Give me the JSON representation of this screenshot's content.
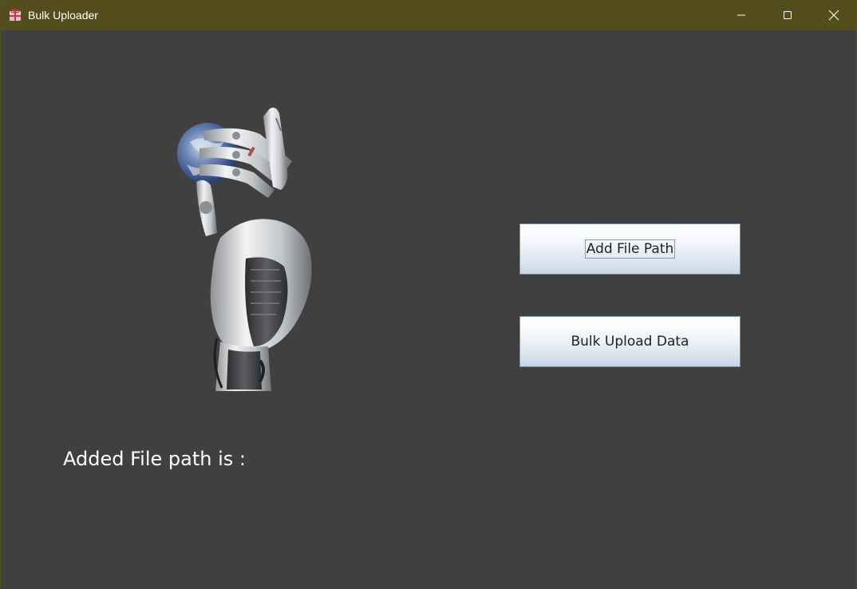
{
  "window": {
    "title": "Bulk Uploader",
    "app_icon": "package-icon",
    "controls": {
      "minimize_icon": "minimize-icon",
      "maximize_icon": "maximize-icon",
      "close_icon": "close-icon"
    }
  },
  "main": {
    "image": "robot-hand-holding-globe",
    "add_file_path_label": "Add File Path",
    "bulk_upload_label": "Bulk Upload Data",
    "file_path_label": "Added File path is :"
  },
  "colors": {
    "titlebar": "#544d1d",
    "background": "#404040",
    "button_top": "#ffffff",
    "button_bottom": "#c7d5e4",
    "label_text": "#ffffff"
  }
}
